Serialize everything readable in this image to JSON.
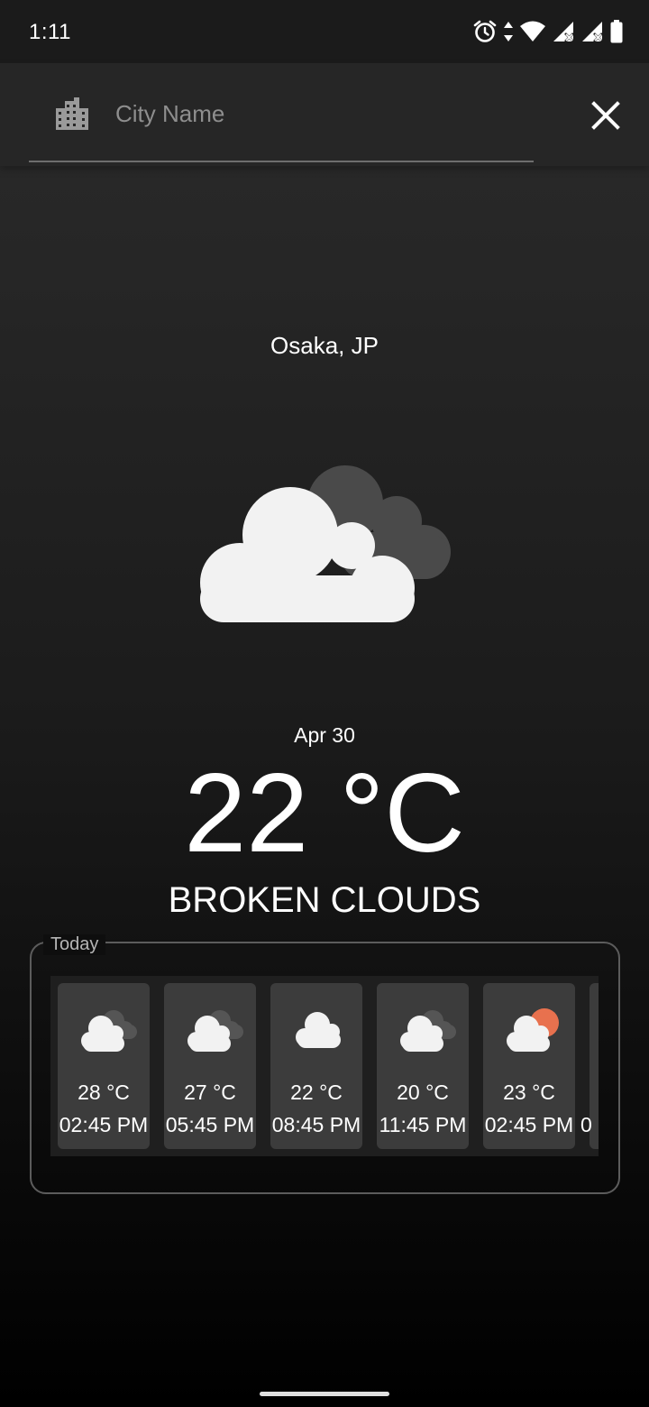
{
  "status_bar": {
    "time": "1:11",
    "icons": [
      "alarm-icon",
      "data-arrows-icon",
      "wifi-icon",
      "signal-icon",
      "signal-icon",
      "battery-icon"
    ]
  },
  "search": {
    "placeholder": "City Name",
    "value": "",
    "leading_icon": "city-building-icon",
    "trailing_icon": "close-icon"
  },
  "weather": {
    "location": "Osaka, JP",
    "icon": "broken-clouds-icon",
    "date": "Apr 30",
    "temperature": "22 °C",
    "description": "BROKEN CLOUDS"
  },
  "today": {
    "label": "Today",
    "forecast": [
      {
        "temp": "28 °C",
        "time": "02:45 PM",
        "icon": "broken-clouds-icon"
      },
      {
        "temp": "27 °C",
        "time": "05:45 PM",
        "icon": "broken-clouds-icon"
      },
      {
        "temp": "22 °C",
        "time": "08:45 PM",
        "icon": "cloud-icon"
      },
      {
        "temp": "20 °C",
        "time": "11:45 PM",
        "icon": "broken-clouds-icon"
      },
      {
        "temp": "23 °C",
        "time": "02:45 PM",
        "icon": "sun-cloud-icon"
      },
      {
        "temp": "",
        "time": "0",
        "icon": ""
      }
    ]
  },
  "colors": {
    "background_top": "#2b2b2b",
    "background_bottom": "#000000",
    "card": "#3c3c3c",
    "sun": "#e8714e"
  }
}
